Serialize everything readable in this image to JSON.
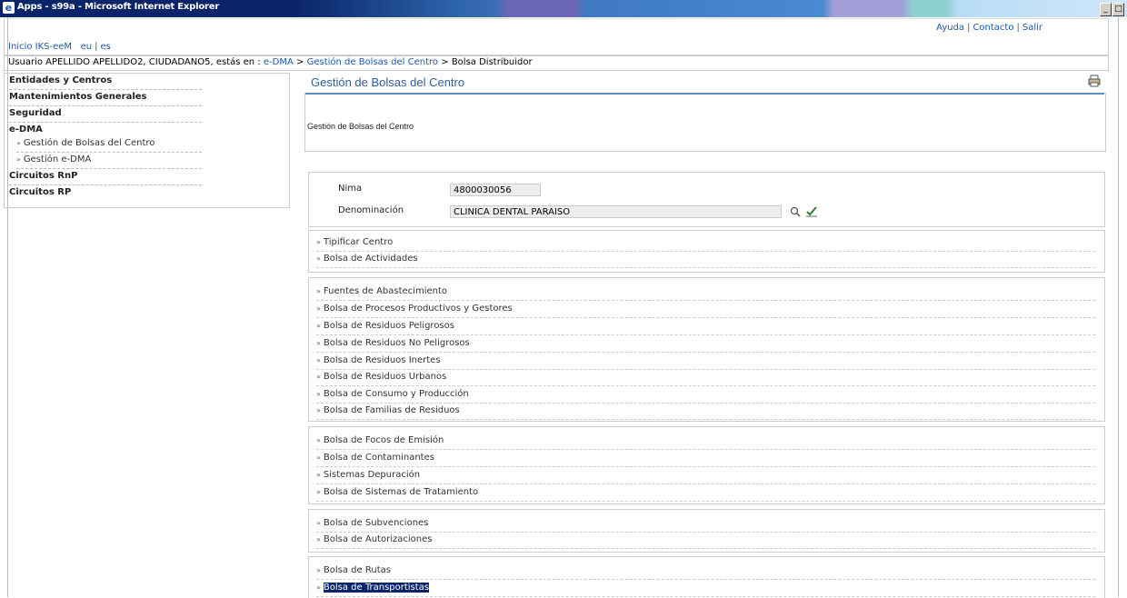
{
  "window": {
    "title": "Apps - s99a - Microsoft Internet Explorer"
  },
  "header": {
    "home_link": "Inicio IKS-eeM",
    "lang_eu": "eu",
    "lang_es": "es",
    "help": "Ayuda",
    "contact": "Contacto",
    "logout": "Salir"
  },
  "breadcrumb": {
    "prefix": "Usuario APELLIDO APELLIDO2, CIUDADANO5, estás en :",
    "crumb1": "e-DMA",
    "crumb2": "Gestión de Bolsas del Centro",
    "current": "Bolsa Distribuidor"
  },
  "sidebar": {
    "items": [
      "Entidades y Centros",
      "Mantenimientos Generales",
      "Seguridad",
      "e-DMA",
      "Gestión de Bolsas del Centro",
      "Gestión e-DMA",
      "Circuitos RnP",
      "Circuitos RP"
    ]
  },
  "main": {
    "title": "Gestión de Bolsas del Centro",
    "description": "Gestión de Bolsas del Centro",
    "nima_label": "Nima",
    "nima_value": "4800030056",
    "denominacion_label": "Denominación",
    "denominacion_value": "CLINICA DENTAL PARAISO"
  },
  "groups": [
    [
      "Tipificar Centro",
      "Bolsa de Actividades"
    ],
    [
      "Fuentes de Abastecimiento",
      "Bolsa de Procesos Productivos y Gestores",
      "Bolsa de Residuos Peligrosos",
      "Bolsa de Residuos No Peligrosos",
      "Bolsa de Residuos Inertes",
      "Bolsa de Residuos Urbanos",
      "Bolsa de Consumo y Producción",
      "Bolsa de Familias de Residuos"
    ],
    [
      "Bolsa de Focos de Emisión",
      "Bolsa de Contaminantes",
      "Sistemas Depuración",
      "Bolsa de Sistemas de Tratamiento"
    ],
    [
      "Bolsa de Subvenciones",
      "Bolsa de Autorizaciones"
    ],
    [
      "Bolsa de Rutas",
      "Bolsa de Transportistas"
    ]
  ],
  "selected_item": "Bolsa de Transportistas",
  "icons": {
    "browser": "ie-icon",
    "print": "printer-icon",
    "search": "search-icon",
    "validate": "check-icon"
  },
  "colors": {
    "link": "#1d5aa8",
    "title_blue": "#2f5f99",
    "selection": "#0a246a"
  }
}
